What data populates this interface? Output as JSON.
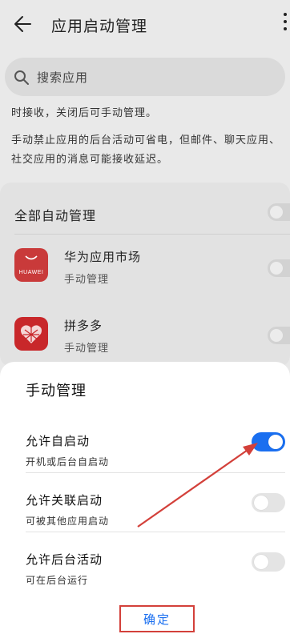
{
  "header": {
    "title": "应用启动管理"
  },
  "search": {
    "placeholder": "搜索应用"
  },
  "description": {
    "line1": "时接收，关闭后可手动管理。",
    "line2": "手动禁止应用的后台活动可省电，但邮件、聊天应用、社交应用的消息可能接收延迟。"
  },
  "list": {
    "all_label": "全部自动管理",
    "apps": [
      {
        "name": "华为应用市场",
        "status": "手动管理",
        "logo_text": "HUAWEI",
        "icon": "huawei-appgallery-icon",
        "color": "#c93a3a"
      },
      {
        "name": "拼多多",
        "status": "手动管理",
        "logo_text": "",
        "icon": "pinduoduo-icon",
        "color": "#c8272a"
      }
    ]
  },
  "sheet": {
    "title": "手动管理",
    "options": [
      {
        "title": "允许自启动",
        "subtitle": "开机或后台自启动",
        "enabled": true
      },
      {
        "title": "允许关联启动",
        "subtitle": "可被其他应用启动",
        "enabled": false
      },
      {
        "title": "允许后台活动",
        "subtitle": "可在后台运行",
        "enabled": false
      }
    ],
    "confirm_label": "确定"
  },
  "colors": {
    "accent": "#1a6ff0",
    "highlight": "#d3403a"
  }
}
